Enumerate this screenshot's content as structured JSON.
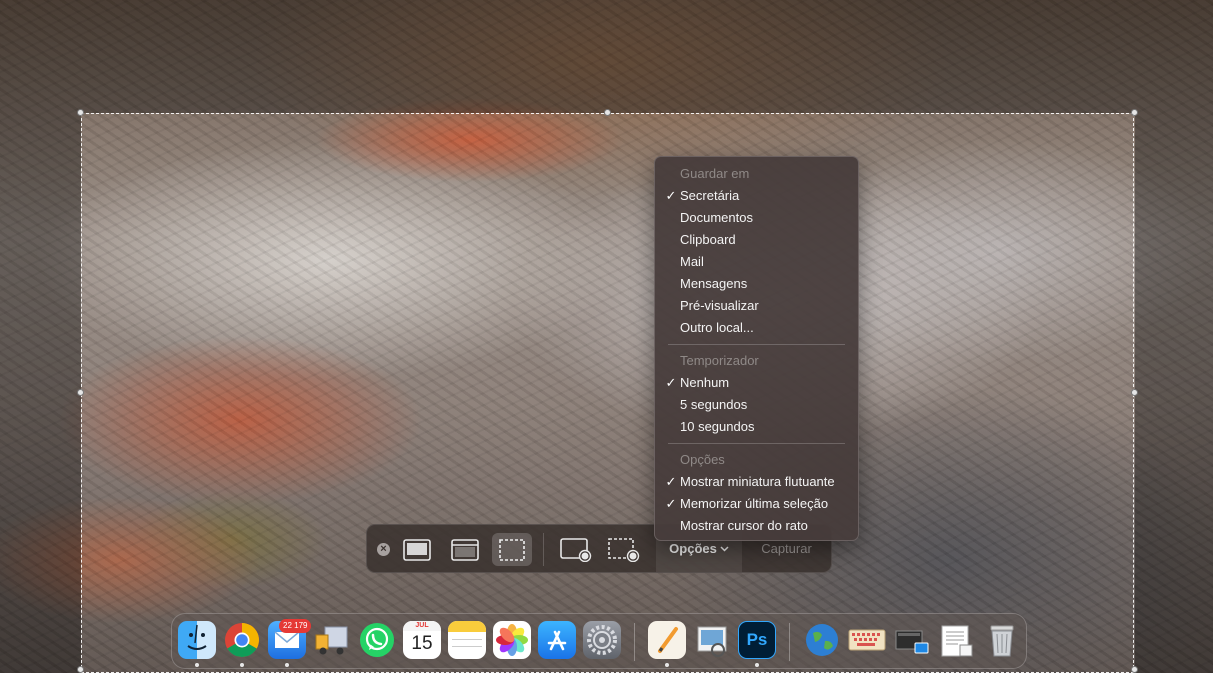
{
  "menu": {
    "sections": [
      {
        "header": "Guardar em",
        "items": [
          {
            "label": "Secretária",
            "checked": true
          },
          {
            "label": "Documentos",
            "checked": false
          },
          {
            "label": "Clipboard",
            "checked": false
          },
          {
            "label": "Mail",
            "checked": false
          },
          {
            "label": "Mensagens",
            "checked": false
          },
          {
            "label": "Pré-visualizar",
            "checked": false
          },
          {
            "label": "Outro local...",
            "checked": false
          }
        ]
      },
      {
        "header": "Temporizador",
        "items": [
          {
            "label": "Nenhum",
            "checked": true
          },
          {
            "label": "5 segundos",
            "checked": false
          },
          {
            "label": "10 segundos",
            "checked": false
          }
        ]
      },
      {
        "header": "Opções",
        "items": [
          {
            "label": "Mostrar miniatura flutuante",
            "checked": true
          },
          {
            "label": "Memorizar última seleção",
            "checked": true
          },
          {
            "label": "Mostrar cursor do rato",
            "checked": false
          }
        ]
      }
    ]
  },
  "toolbar": {
    "close_icon": "close-icon",
    "modes": [
      "capture-entire-screen-icon",
      "capture-window-icon",
      "capture-selection-icon",
      "record-screen-icon",
      "record-selection-icon"
    ],
    "active_mode": "capture-selection-icon",
    "options_label": "Opções",
    "capture_label": "Capturar"
  },
  "dock": {
    "apps": [
      {
        "name": "finder-icon",
        "running": true
      },
      {
        "name": "chrome-icon",
        "running": true
      },
      {
        "name": "mail-icon",
        "running": true
      },
      {
        "name": "transmit-truck-icon",
        "running": false
      },
      {
        "name": "whatsapp-icon",
        "running": false
      },
      {
        "name": "calendar-icon",
        "running": false
      },
      {
        "name": "notes-icon",
        "running": false
      },
      {
        "name": "photos-icon",
        "running": false
      },
      {
        "name": "app-store-icon",
        "running": false
      },
      {
        "name": "system-settings-icon",
        "running": false
      },
      {
        "name": "pages-icon",
        "running": true
      },
      {
        "name": "preview-icon",
        "running": false
      },
      {
        "name": "photoshop-icon",
        "running": true
      },
      {
        "name": "globe-folder-icon",
        "running": false
      },
      {
        "name": "keyboard-folder-icon",
        "running": false
      },
      {
        "name": "screens-folder-icon",
        "running": false
      },
      {
        "name": "documents-stack-icon",
        "running": false
      },
      {
        "name": "trash-icon",
        "running": false
      }
    ],
    "mail_badge": "22 179",
    "calendar_month": "JUL",
    "calendar_day": "15",
    "photoshop_label": "Ps",
    "colors": {
      "mail": "#1e88e5",
      "whatsapp": "#25d366",
      "appstore": "#1a8cff",
      "photoshop": "#001e36"
    }
  }
}
